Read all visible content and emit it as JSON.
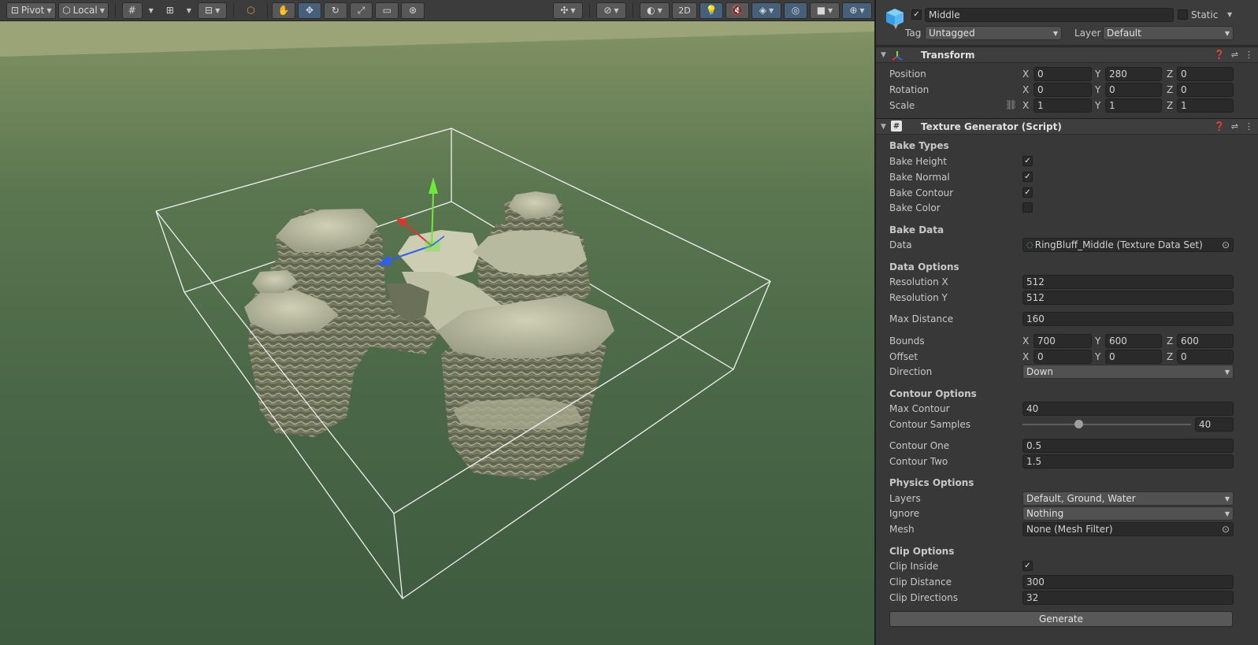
{
  "toolbar": {
    "pivot_label": "Pivot",
    "local_label": "Local",
    "mode_2d_label": "2D"
  },
  "inspector": {
    "object_name": "Middle",
    "active_checked": true,
    "static_label": "Static",
    "static_checked": false,
    "tag_label": "Tag",
    "tag_value": "Untagged",
    "layer_label": "Layer",
    "layer_value": "Default"
  },
  "transform": {
    "title": "Transform",
    "position_label": "Position",
    "rotation_label": "Rotation",
    "scale_label": "Scale",
    "axis_x": "X",
    "axis_y": "Y",
    "axis_z": "Z",
    "position": {
      "x": "0",
      "y": "280",
      "z": "0"
    },
    "rotation": {
      "x": "0",
      "y": "0",
      "z": "0"
    },
    "scale": {
      "x": "1",
      "y": "1",
      "z": "1"
    }
  },
  "texture_generator": {
    "title": "Texture Generator (Script)",
    "bake_types_label": "Bake Types",
    "bake_height_label": "Bake Height",
    "bake_height": true,
    "bake_normal_label": "Bake Normal",
    "bake_normal": true,
    "bake_contour_label": "Bake Contour",
    "bake_contour": true,
    "bake_color_label": "Bake Color",
    "bake_color": false,
    "bake_data_label": "Bake Data",
    "data_label": "Data",
    "data_value": "RingBluff_Middle (Texture Data Set)",
    "data_options_label": "Data Options",
    "resolution_x_label": "Resolution X",
    "resolution_x": "512",
    "resolution_y_label": "Resolution Y",
    "resolution_y": "512",
    "max_distance_label": "Max Distance",
    "max_distance": "160",
    "bounds_label": "Bounds",
    "bounds": {
      "x": "700",
      "y": "600",
      "z": "600"
    },
    "offset_label": "Offset",
    "offset": {
      "x": "0",
      "y": "0",
      "z": "0"
    },
    "direction_label": "Direction",
    "direction": "Down",
    "contour_options_label": "Contour Options",
    "max_contour_label": "Max Contour",
    "max_contour": "40",
    "contour_samples_label": "Contour Samples",
    "contour_samples": "40",
    "contour_samples_fraction": 0.33,
    "contour_one_label": "Contour One",
    "contour_one": "0.5",
    "contour_two_label": "Contour Two",
    "contour_two": "1.5",
    "physics_options_label": "Physics Options",
    "layers_label": "Layers",
    "layers": "Default, Ground, Water",
    "ignore_label": "Ignore",
    "ignore": "Nothing",
    "mesh_label": "Mesh",
    "mesh": "None (Mesh Filter)",
    "clip_options_label": "Clip Options",
    "clip_inside_label": "Clip Inside",
    "clip_inside": true,
    "clip_distance_label": "Clip Distance",
    "clip_distance": "300",
    "clip_directions_label": "Clip Directions",
    "clip_directions": "32",
    "generate_label": "Generate"
  },
  "colors": {
    "accent": "#46607c",
    "panel": "#383838",
    "field": "#2a2a2a",
    "gizmo_x": "#e0322e",
    "gizmo_y": "#6ee83a",
    "gizmo_z": "#2e5ef0"
  }
}
